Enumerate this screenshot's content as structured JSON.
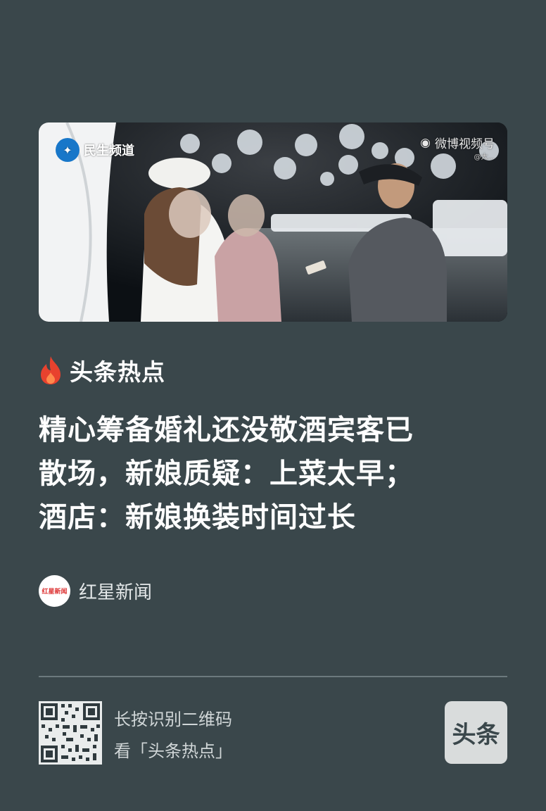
{
  "hero": {
    "watermark_left": "民生频道",
    "watermark_right": "微博视频号",
    "watermark_right_sub": "@大..."
  },
  "section": {
    "icon": "fire-icon",
    "label": "头条热点"
  },
  "headline": {
    "lines": [
      "精心筹备婚礼还没敬酒宾客已",
      "散场，新娘质疑：上菜太早；",
      "酒店：新娘换装时间过长"
    ]
  },
  "source": {
    "avatar_text": "红星新闻",
    "name": "红星新闻"
  },
  "footer": {
    "cta_line1": "长按识别二维码",
    "cta_line2": "看「头条热点」",
    "badge": "头条"
  },
  "colors": {
    "background": "#3a474b",
    "accent": "#e8422e"
  }
}
